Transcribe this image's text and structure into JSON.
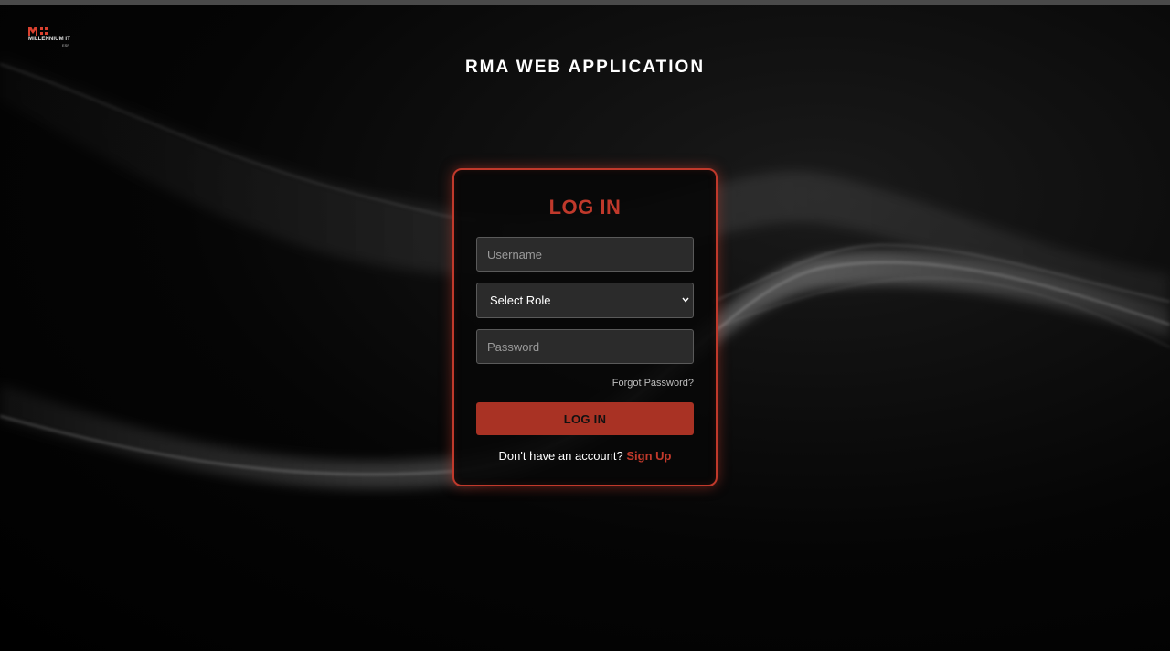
{
  "logo": {
    "brand_text": "MILLENNIUM IT",
    "sub_text": "ESP",
    "accent_color": "#d9412f"
  },
  "header": {
    "app_title": "RMA WEB APPLICATION"
  },
  "login_form": {
    "title": "LOG IN",
    "username_placeholder": "Username",
    "username_value": "",
    "role_selected": "Select Role",
    "password_placeholder": "Password",
    "password_value": "",
    "forgot_password": "Forgot Password?",
    "submit_label": "LOG IN",
    "signup_prompt": "Don't have an account?",
    "signup_link": "Sign Up"
  },
  "colors": {
    "accent": "#c0392b",
    "button": "#a93224",
    "background": "#000000",
    "field_bg": "#2b2b2b"
  },
  "icons": {
    "role_dropdown": "chevron-down-icon",
    "logo": "millennium-it-logo-icon"
  }
}
